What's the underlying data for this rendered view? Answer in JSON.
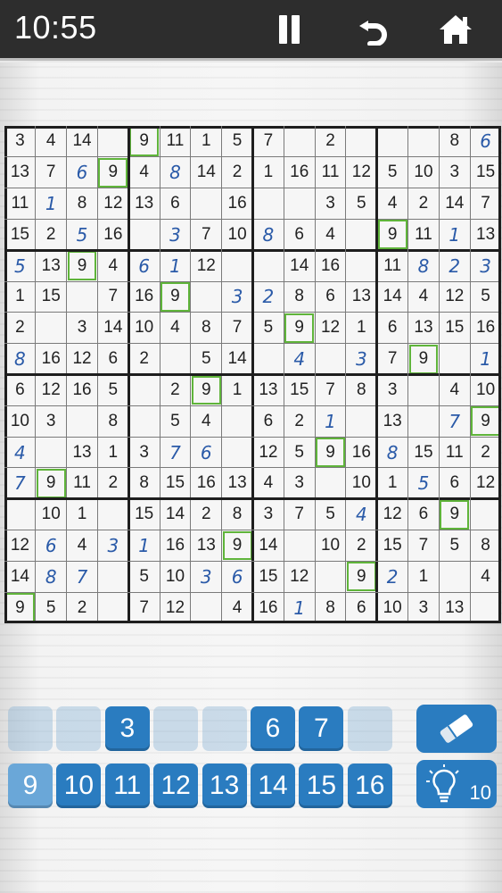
{
  "status_bar": {
    "time": "10:55"
  },
  "toolbar": {
    "pause_icon": "pause-icon",
    "undo_icon": "undo-icon",
    "home_icon": "home-icon"
  },
  "colors": {
    "given": "#222222",
    "user_entry": "#2a5aa8",
    "highlight": "#5fb43a",
    "key_active": "#2a7cc0"
  },
  "board": {
    "size": 16,
    "box": 4,
    "rows": [
      [
        "3",
        "4",
        "14",
        "",
        "9",
        "11",
        "1",
        "5",
        "7",
        "",
        "2",
        "",
        "",
        "",
        "8",
        "6"
      ],
      [
        "13",
        "7",
        "6",
        "9",
        "4",
        "8",
        "14",
        "2",
        "1",
        "16",
        "11",
        "12",
        "5",
        "10",
        "3",
        "15"
      ],
      [
        "11",
        "1",
        "8",
        "12",
        "13",
        "6",
        "",
        "16",
        "",
        "",
        "3",
        "5",
        "4",
        "2",
        "14",
        "7"
      ],
      [
        "15",
        "2",
        "5",
        "16",
        "",
        "3",
        "7",
        "10",
        "8",
        "6",
        "4",
        "",
        "9",
        "11",
        "1",
        "13"
      ],
      [
        "5",
        "13",
        "9",
        "4",
        "6",
        "1",
        "12",
        "",
        "",
        "14",
        "16",
        "",
        "11",
        "8",
        "2",
        "3"
      ],
      [
        "1",
        "15",
        "",
        "7",
        "16",
        "9",
        "",
        "3",
        "2",
        "8",
        "6",
        "13",
        "14",
        "4",
        "12",
        "5"
      ],
      [
        "2",
        "",
        "3",
        "14",
        "10",
        "4",
        "8",
        "7",
        "5",
        "9",
        "12",
        "1",
        "6",
        "13",
        "15",
        "16"
      ],
      [
        "8",
        "16",
        "12",
        "6",
        "2",
        "",
        "5",
        "14",
        "",
        "4",
        "",
        "3",
        "7",
        "9",
        "",
        "1"
      ],
      [
        "6",
        "12",
        "16",
        "5",
        "",
        "2",
        "9",
        "1",
        "13",
        "15",
        "7",
        "8",
        "3",
        "",
        "4",
        "10"
      ],
      [
        "10",
        "3",
        "",
        "8",
        "",
        "5",
        "4",
        "",
        "6",
        "2",
        "1",
        "",
        "13",
        "",
        "7",
        "9"
      ],
      [
        "4",
        "",
        "13",
        "1",
        "3",
        "7",
        "6",
        "",
        "12",
        "5",
        "9",
        "16",
        "8",
        "15",
        "11",
        "2"
      ],
      [
        "7",
        "9",
        "11",
        "2",
        "8",
        "15",
        "16",
        "13",
        "4",
        "3",
        "",
        "10",
        "1",
        "5",
        "6",
        "12"
      ],
      [
        "",
        "10",
        "1",
        "",
        "15",
        "14",
        "2",
        "8",
        "3",
        "7",
        "5",
        "4",
        "12",
        "6",
        "9",
        ""
      ],
      [
        "12",
        "6",
        "4",
        "3",
        "1",
        "16",
        "13",
        "9",
        "14",
        "",
        "10",
        "2",
        "15",
        "7",
        "5",
        "8"
      ],
      [
        "14",
        "8",
        "7",
        "",
        "5",
        "10",
        "3",
        "6",
        "15",
        "12",
        "",
        "9",
        "2",
        "1",
        "",
        "4"
      ],
      [
        "9",
        "5",
        "2",
        "",
        "7",
        "12",
        "",
        "4",
        "16",
        "1",
        "8",
        "6",
        "10",
        "3",
        "13",
        ""
      ]
    ],
    "user_entries": [
      [
        0,
        15
      ],
      [
        1,
        2
      ],
      [
        1,
        5
      ],
      [
        2,
        1
      ],
      [
        3,
        2
      ],
      [
        3,
        5
      ],
      [
        3,
        8
      ],
      [
        3,
        14
      ],
      [
        4,
        0
      ],
      [
        4,
        4
      ],
      [
        4,
        5
      ],
      [
        4,
        13
      ],
      [
        4,
        14
      ],
      [
        4,
        15
      ],
      [
        5,
        7
      ],
      [
        5,
        8
      ],
      [
        7,
        0
      ],
      [
        7,
        9
      ],
      [
        7,
        11
      ],
      [
        7,
        15
      ],
      [
        9,
        10
      ],
      [
        9,
        14
      ],
      [
        10,
        0
      ],
      [
        10,
        5
      ],
      [
        10,
        6
      ],
      [
        10,
        12
      ],
      [
        11,
        0
      ],
      [
        11,
        13
      ],
      [
        12,
        11
      ],
      [
        13,
        1
      ],
      [
        13,
        3
      ],
      [
        13,
        4
      ],
      [
        14,
        1
      ],
      [
        14,
        2
      ],
      [
        14,
        6
      ],
      [
        14,
        7
      ],
      [
        14,
        12
      ],
      [
        15,
        9
      ]
    ],
    "highlighted": [
      [
        0,
        4
      ],
      [
        1,
        3
      ],
      [
        3,
        12
      ],
      [
        4,
        2
      ],
      [
        5,
        5
      ],
      [
        6,
        9
      ],
      [
        7,
        13
      ],
      [
        8,
        6
      ],
      [
        9,
        15
      ],
      [
        10,
        10
      ],
      [
        11,
        1
      ],
      [
        12,
        14
      ],
      [
        13,
        7
      ],
      [
        14,
        11
      ],
      [
        15,
        0
      ]
    ]
  },
  "keypad": {
    "row1": [
      {
        "label": "",
        "state": "faded"
      },
      {
        "label": "",
        "state": "faded"
      },
      {
        "label": "3",
        "state": "active"
      },
      {
        "label": "",
        "state": "faded"
      },
      {
        "label": "",
        "state": "faded"
      },
      {
        "label": "6",
        "state": "active"
      },
      {
        "label": "7",
        "state": "active"
      },
      {
        "label": "",
        "state": "faded"
      }
    ],
    "row2": [
      {
        "label": "9",
        "state": "selected"
      },
      {
        "label": "10",
        "state": "active"
      },
      {
        "label": "11",
        "state": "active"
      },
      {
        "label": "12",
        "state": "active"
      },
      {
        "label": "13",
        "state": "active"
      },
      {
        "label": "14",
        "state": "active"
      },
      {
        "label": "15",
        "state": "active"
      },
      {
        "label": "16",
        "state": "active"
      }
    ],
    "eraser_icon": "eraser-icon",
    "hint_icon": "lightbulb-icon",
    "hint_count": "10"
  }
}
